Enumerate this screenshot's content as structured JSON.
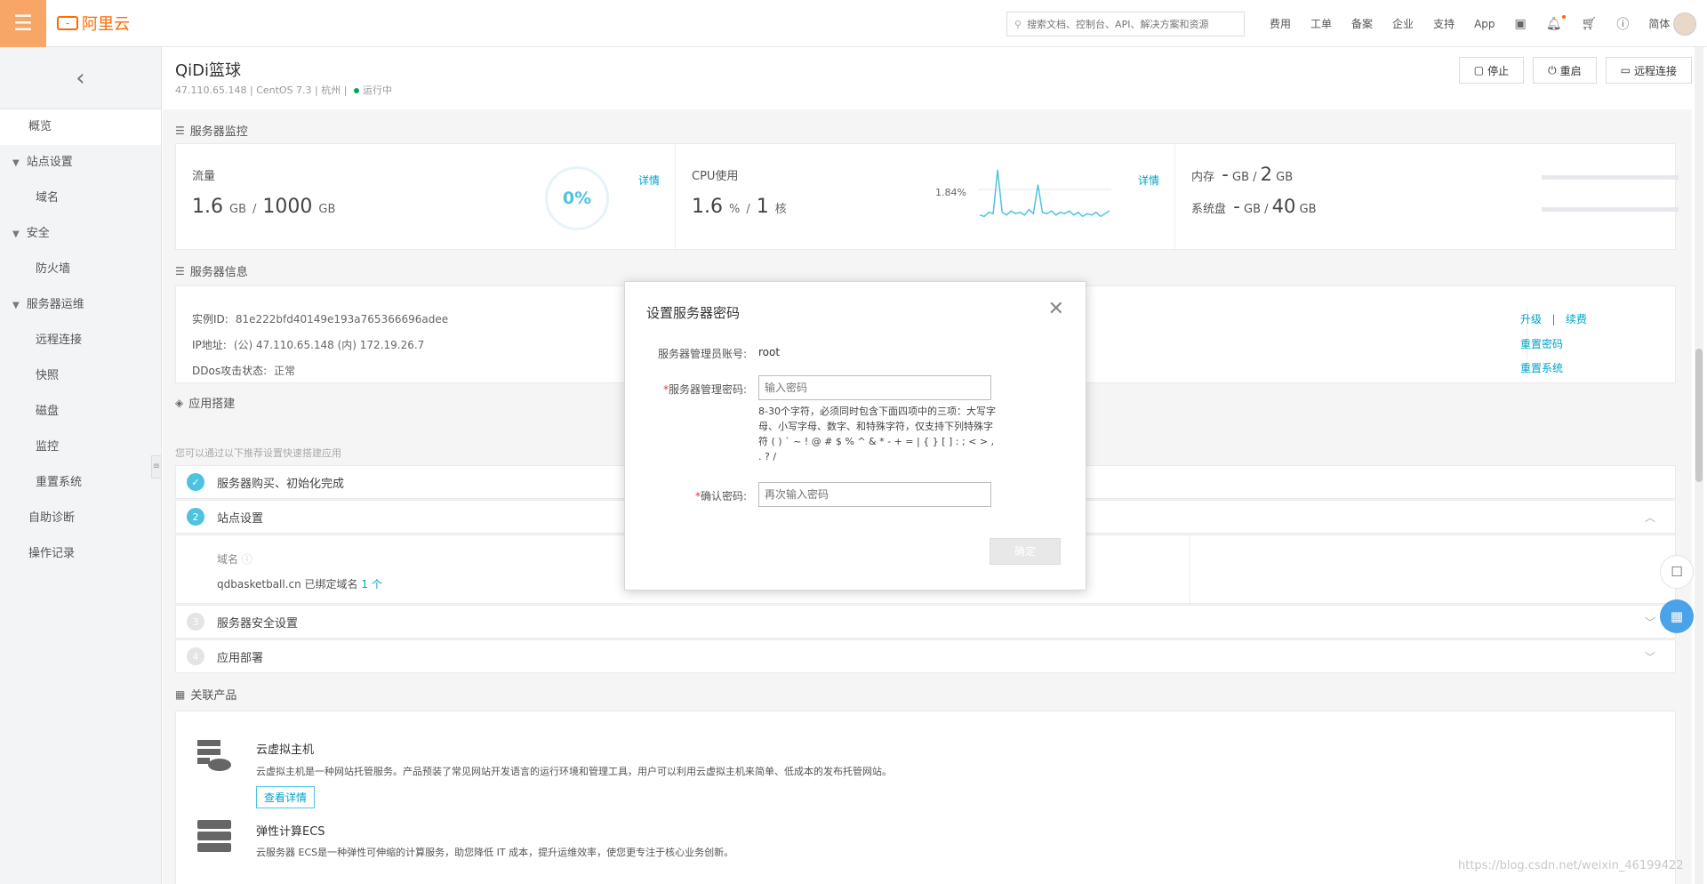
{
  "topbar": {
    "logo_text": "阿里云",
    "search_placeholder": "搜索文档、控制台、API、解决方案和资源",
    "nav": [
      "费用",
      "工单",
      "备案",
      "企业",
      "支持",
      "App"
    ],
    "lang": "简体"
  },
  "sidebar": {
    "items": [
      {
        "label": "概览"
      },
      {
        "label": "站点设置"
      },
      {
        "label": "域名"
      },
      {
        "label": "安全"
      },
      {
        "label": "防火墙"
      },
      {
        "label": "服务器运维"
      },
      {
        "label": "远程连接"
      },
      {
        "label": "快照"
      },
      {
        "label": "磁盘"
      },
      {
        "label": "监控"
      },
      {
        "label": "重置系统"
      },
      {
        "label": "自助诊断"
      },
      {
        "label": "操作记录"
      }
    ]
  },
  "header": {
    "server_name": "QiDi篮球",
    "ip": "47.110.65.148",
    "os": "CentOS 7.3",
    "region": "杭州",
    "status": "运行中",
    "buttons": {
      "stop": "停止",
      "restart": "重启",
      "remote": "远程连接"
    }
  },
  "monitor": {
    "section_title": "服务器监控",
    "traffic": {
      "label": "流量",
      "used": "1.6",
      "used_unit": "GB",
      "total": "1000",
      "total_unit": "GB",
      "gauge": "0%",
      "detail": "详情"
    },
    "cpu": {
      "label": "CPU使用",
      "used": "1.6",
      "used_unit": "%",
      "total": "1",
      "total_unit": "核",
      "peak": "1.84%",
      "detail": "详情"
    },
    "memory": {
      "label": "内存",
      "used": "-",
      "used_unit": "GB",
      "total": "2",
      "total_unit": "GB"
    },
    "disk": {
      "label": "系统盘",
      "used": "-",
      "used_unit": "GB",
      "total": "40",
      "total_unit": "GB"
    },
    "cpu_series": [
      0.2,
      0.15,
      0.3,
      0.25,
      1.84,
      0.3,
      0.2,
      0.35,
      0.25,
      0.3,
      0.2,
      0.4,
      0.25,
      1.3,
      0.3,
      0.25,
      0.35,
      0.2,
      0.3,
      0.25,
      0.35,
      0.2,
      0.3,
      0.15,
      0.25,
      0.2,
      0.3,
      0.15,
      0.25,
      0.35
    ]
  },
  "info": {
    "section_title": "服务器信息",
    "instance_id_label": "实例ID:",
    "instance_id": "81e222bfd40149e193a765366696adee",
    "ip_label": "IP地址:",
    "ip": "(公) 47.110.65.148 (内) 172.19.26.7",
    "ddos_label": "DDos攻击状态:",
    "ddos": "正常",
    "links": {
      "upgrade": "升级",
      "renew": "续费",
      "reset_pwd": "重置密码",
      "reset_sys": "重置系统"
    }
  },
  "build": {
    "section_title": "应用搭建",
    "subtitle": "您可以通过以下推荐设置快速搭建应用",
    "steps": [
      {
        "num": "✓",
        "label": "服务器购买、初始化完成"
      },
      {
        "num": "2",
        "label": "站点设置"
      },
      {
        "num": "3",
        "label": "服务器安全设置"
      },
      {
        "num": "4",
        "label": "应用部署"
      }
    ],
    "domain_label": "域名",
    "domain_value": "qdbasketball.cn 已绑定域名",
    "domain_count": "1 个"
  },
  "related": {
    "section_title": "关联产品",
    "products": [
      {
        "title": "云虚拟主机",
        "desc": "云虚拟主机是一种网站托管服务。产品预装了常见网站开发语言的运行环境和管理工具，用户可以利用云虚拟主机来简单、低成本的发布托管网站。",
        "button": "查看详情"
      },
      {
        "title": "弹性计算ECS",
        "desc": "云服务器 ECS是一种弹性可伸缩的计算服务，助您降低 IT 成本，提升运维效率，使您更专注于核心业务创新。"
      }
    ]
  },
  "dialog": {
    "title": "设置服务器密码",
    "account_label": "服务器管理员账号:",
    "account_value": "root",
    "password_label": "服务器管理密码:",
    "password_placeholder": "输入密码",
    "hint": "8-30个字符，必须同时包含下面四项中的三项：大写字母、小写字母、数字、和特殊字符，仅支持下列特殊字符 ( ) ` ~ ! @ # $ % ^ & * - + = | { } [ ] : ; < > , . ? /",
    "confirm_label": "确认密码:",
    "confirm_placeholder": "再次输入密码",
    "ok": "确定"
  },
  "watermark": "https://blog.csdn.net/weixin_46199422"
}
